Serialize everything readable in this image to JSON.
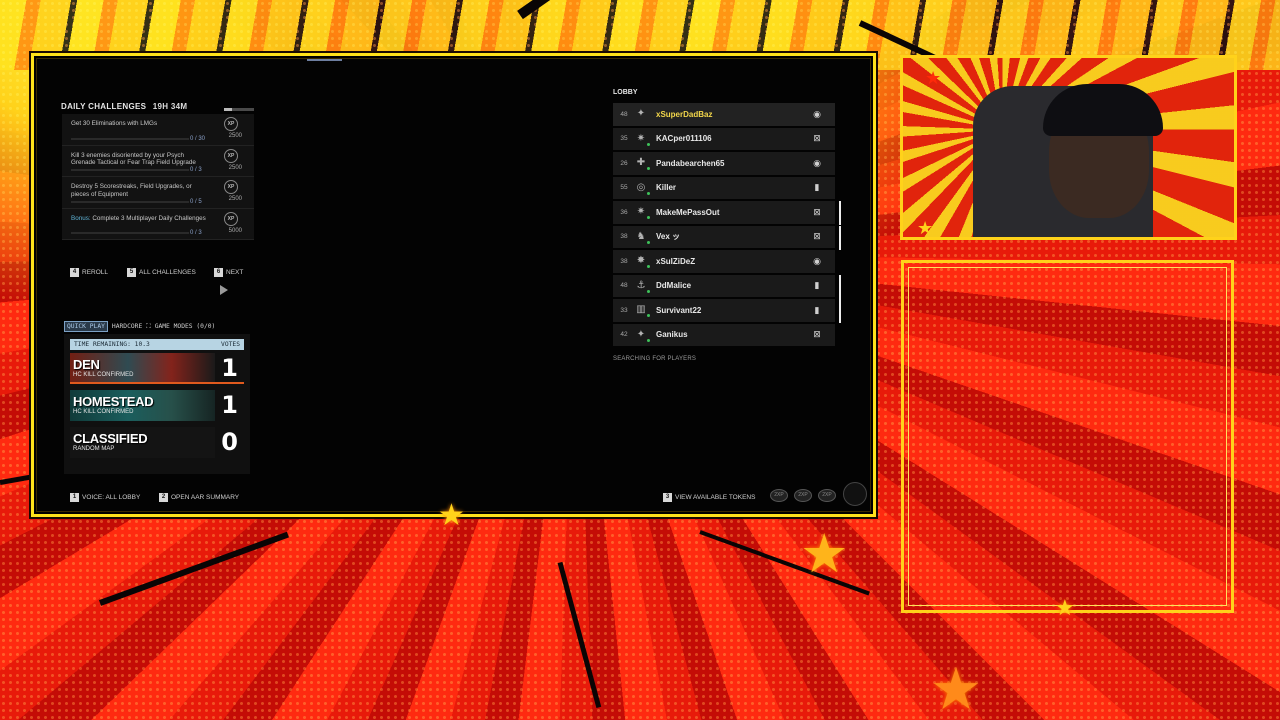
{
  "daily_challenges": {
    "title": "DAILY CHALLENGES",
    "timer": "19H 34M",
    "items": [
      {
        "text": "Get 30 Eliminations with LMGs",
        "bonus": "",
        "progress": "0 / 30",
        "xp": "2500"
      },
      {
        "text": "Kill 3 enemies disoriented by your Psych Grenade Tactical or Fear Trap Field Upgrade",
        "bonus": "",
        "progress": "0 / 3",
        "xp": "2500"
      },
      {
        "text": "Destroy 5 Scorestreaks, Field Upgrades, or pieces of Equipment",
        "bonus": "",
        "progress": "0 / 5",
        "xp": "2500"
      },
      {
        "text": " Complete 3 Multiplayer Daily Challenges",
        "bonus": "Bonus:",
        "progress": "0 / 3",
        "xp": "5000"
      }
    ],
    "xp_icon": "XP",
    "actions": {
      "reroll_key": "4",
      "reroll": "REROLL",
      "all_key": "5",
      "all": "ALL CHALLENGES",
      "next_key": "6",
      "next": "NEXT"
    }
  },
  "modes": {
    "quick_play": "QUICK PLAY",
    "hardcore": "HARDCORE",
    "game_modes": "GAME MODES (0/0)",
    "time_remaining": "TIME REMAINING: 10.3",
    "votes_label": "VOTES",
    "maps": [
      {
        "name": "DEN",
        "sub": "HC KILL CONFIRMED",
        "votes": "1"
      },
      {
        "name": "HOMESTEAD",
        "sub": "HC KILL CONFIRMED",
        "votes": "1"
      },
      {
        "name": "CLASSIFIED",
        "sub": "RANDOM MAP",
        "votes": "0"
      }
    ]
  },
  "bottom_actions": {
    "voice_key": "1",
    "voice": "VOICE: ALL LOBBY",
    "aar_key": "2",
    "aar": "OPEN AAR SUMMARY",
    "tokens_key": "3",
    "tokens": "VIEW AVAILABLE TOKENS"
  },
  "lobby": {
    "title": "LOBBY",
    "searching": "SEARCHING FOR PLAYERS",
    "players": [
      {
        "level": "48",
        "name": "xSuperDadBaz",
        "platform": "steam-icon",
        "me": true
      },
      {
        "level": "35",
        "name": "KACper011106",
        "platform": "xbox-icon",
        "me": false
      },
      {
        "level": "26",
        "name": "Pandabearchen65",
        "platform": "steam-icon",
        "me": false
      },
      {
        "level": "55",
        "name": "Killer",
        "platform": "mobile-icon",
        "me": false
      },
      {
        "level": "36",
        "name": "MakeMePassOut",
        "platform": "xbox-icon",
        "me": false
      },
      {
        "level": "38",
        "name": "Vex ッ",
        "platform": "xbox-icon",
        "me": false
      },
      {
        "level": "38",
        "name": "xSuIZiDeZ",
        "platform": "steam-icon",
        "me": false
      },
      {
        "level": "48",
        "name": "DdMalice",
        "platform": "mobile-icon",
        "me": false
      },
      {
        "level": "33",
        "name": "Survivant22",
        "platform": "mobile-icon",
        "me": false
      },
      {
        "level": "42",
        "name": "Ganikus",
        "platform": "xbox-icon",
        "me": false
      }
    ]
  },
  "tokens": [
    "2XP",
    "2XP",
    "2XP"
  ],
  "colors": {
    "frame": "#ffe21a",
    "accent": "#f2d64b",
    "online": "#3ec25a"
  }
}
